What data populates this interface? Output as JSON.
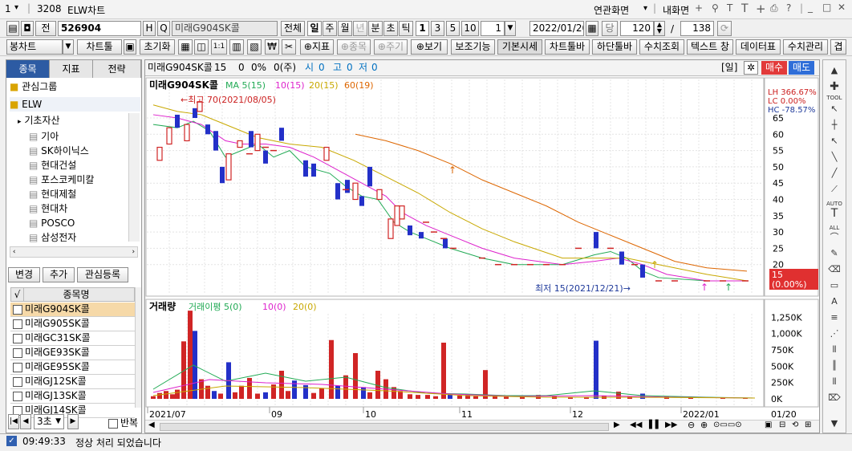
{
  "window": {
    "menu_arrow": "1",
    "number": "3208",
    "title": "ELW차트",
    "layout_menu": "연관화면",
    "my_screen": "내화면",
    "tool_icons": [
      "Q",
      "T",
      "T",
      "+",
      "print",
      "?"
    ]
  },
  "toolbar1": {
    "period_no": "1",
    "code": "526904",
    "h_label": "H",
    "search_glyph": "Q",
    "name": "미래G904SK콜",
    "total": "전체",
    "periods": [
      "일",
      "주",
      "월",
      "년",
      "분",
      "초",
      "틱"
    ],
    "active_period": "일",
    "nums": [
      "1",
      "3",
      "5",
      "10"
    ],
    "spin_value": "1",
    "date": "2022/01/20",
    "dang": "당",
    "count": "120",
    "slash": "/",
    "total_count": "138"
  },
  "toolbar2": {
    "chart_type": "봉차트",
    "chart_tools": "차트툴",
    "init": "초기화",
    "sep": "1:1",
    "indicator": "지표",
    "item": "종목",
    "cycle": "주기",
    "view": "보기",
    "buttons": [
      "보조기능",
      "기본시세",
      "차트툴바",
      "하단툴바",
      "수치조회",
      "텍스트 창",
      "데이터표",
      "수치관리",
      "겹"
    ]
  },
  "left": {
    "tabs": [
      "종목",
      "지표",
      "전략"
    ],
    "groups": [
      {
        "label": "관심그룹"
      },
      {
        "label": "ELW"
      }
    ],
    "tree_root": "기초자산",
    "assets": [
      "기아",
      "SK하이닉스",
      "현대건설",
      "포스코케미칼",
      "현대제철",
      "현대차",
      "POSCO",
      "삼성전자"
    ],
    "actions": [
      "변경",
      "추가",
      "관심등록"
    ],
    "col_check": "√",
    "col_name": "종목명",
    "items": [
      "미래G904SK콜",
      "미래G905SK콜",
      "미래GC31SK콜",
      "미래GE93SK콜",
      "미래GE95SK콜",
      "미래GJ12SK콜",
      "미래GJ13SK콜",
      "미래GJ14SK콜"
    ],
    "selected_index": 0,
    "interval": "3초",
    "repeat": "반복"
  },
  "chart_header": {
    "name": "미래G904SK콜",
    "price": "15",
    "change": "0",
    "rate": "0%",
    "vol": "0(주)",
    "open_label": "시",
    "open": "0",
    "high_label": "고",
    "high": "0",
    "low_label": "저",
    "low": "0",
    "period_tag": "[일]",
    "buy": "매수",
    "sell": "매도"
  },
  "price_panel": {
    "title": "미래G904SK콜",
    "legend": [
      "MA 5(15)",
      "10(15)",
      "20(15)",
      "60(19)"
    ],
    "legend_colors": [
      "#22aa55",
      "#dd22cc",
      "#c8a800",
      "#dd6600"
    ],
    "max_note": "←최고 70(2021/08/05)",
    "min_note": "최저 15(2021/12/21)→",
    "lh": "LH 366.67%",
    "lc": "LC   0.00%",
    "hc": "HC -78.57%",
    "last_label": "15",
    "last_rate": "(0.00%)",
    "y_ticks": [
      "65",
      "60",
      "55",
      "50",
      "45",
      "40",
      "35",
      "30",
      "25",
      "20"
    ]
  },
  "volume_panel": {
    "title": "거래량",
    "legend": [
      "거래이평 5(0)",
      "10(0)",
      "20(0)"
    ],
    "legend_colors": [
      "#22aa55",
      "#dd22cc",
      "#c8a800"
    ],
    "y_ticks": [
      "1,250K",
      "1,000K",
      "750K",
      "500K",
      "250K",
      "0K"
    ]
  },
  "x_axis": {
    "labels": [
      "2021/07",
      "09",
      "10",
      "11",
      "12",
      "2022/01"
    ],
    "cursor_date": "01/20"
  },
  "right_tools": [
    "TOOL",
    "AUTO",
    "ALL"
  ],
  "status": {
    "time": "09:49:33",
    "message": "정상 처리 되었습니다"
  },
  "chart_data": {
    "type": "candlestick",
    "title": "미래G904SK콜",
    "ylim": [
      15,
      67
    ],
    "x": [
      "2021-07",
      "2021-09",
      "2021-10",
      "2021-11",
      "2021-12",
      "2022-01"
    ],
    "ohlc_approx": [
      {
        "o": 60,
        "c": 55,
        "dir": "up"
      },
      {
        "o": 56,
        "c": 62,
        "dir": "up"
      },
      {
        "o": 63,
        "c": 68,
        "dir": "up"
      },
      {
        "o": 70,
        "c": 64,
        "dir": "down"
      },
      {
        "o": 62,
        "c": 58,
        "dir": "down"
      },
      {
        "o": 58,
        "c": 50,
        "dir": "down"
      },
      {
        "o": 50,
        "c": 43,
        "dir": "down"
      },
      {
        "o": 48,
        "c": 38,
        "dir": "up"
      },
      {
        "o": 38,
        "c": 33,
        "dir": "up"
      },
      {
        "o": 30,
        "c": 25,
        "dir": "down"
      },
      {
        "o": 30,
        "c": 25,
        "dir": "down"
      },
      {
        "o": 25,
        "c": 20,
        "dir": "down"
      },
      {
        "o": 20,
        "c": 15,
        "dir": "down"
      },
      {
        "o": 15,
        "c": 15,
        "dir": "flat"
      }
    ],
    "volume_approx_k": [
      120,
      80,
      350,
      1300,
      900,
      500,
      700,
      900,
      300,
      800,
      150,
      500,
      80,
      40
    ],
    "max": {
      "value": 70,
      "date": "2021/08/05"
    },
    "min": {
      "value": 15,
      "date": "2021/12/21"
    },
    "ma": [
      {
        "name": "MA 5",
        "period": 5
      },
      {
        "name": "10",
        "period": 10
      },
      {
        "name": "20",
        "period": 20
      },
      {
        "name": "60",
        "period": 60
      }
    ]
  }
}
